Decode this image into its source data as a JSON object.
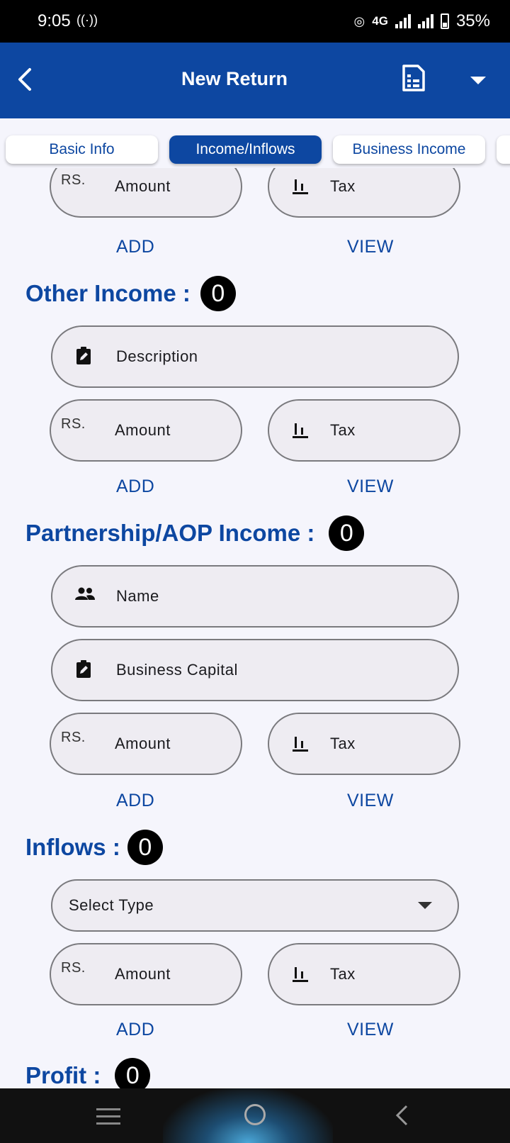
{
  "status": {
    "time": "9:05",
    "network": "4G",
    "battery": "35%"
  },
  "appbar": {
    "title": "New Return"
  },
  "tabs": [
    {
      "label": "Basic Info",
      "active": false
    },
    {
      "label": "Income/Inflows",
      "active": true
    },
    {
      "label": "Business Income",
      "active": false
    }
  ],
  "top_group": {
    "amount_prefix": "RS.",
    "amount_label": "Amount",
    "tax_label": "Tax",
    "add_label": "ADD",
    "view_label": "VIEW"
  },
  "other_income": {
    "title": "Other Income :",
    "count": "0",
    "description_label": "Description",
    "amount_prefix": "RS.",
    "amount_label": "Amount",
    "tax_label": "Tax",
    "add_label": "ADD",
    "view_label": "VIEW"
  },
  "partnership": {
    "title": "Partnership/AOP Income :",
    "count": "0",
    "name_label": "Name",
    "capital_label": "Business Capital",
    "amount_prefix": "RS.",
    "amount_label": "Amount",
    "tax_label": "Tax",
    "add_label": "ADD",
    "view_label": "VIEW"
  },
  "inflows": {
    "title": "Inflows :",
    "count": "0",
    "select_placeholder": "Select Type",
    "amount_prefix": "RS.",
    "amount_label": "Amount",
    "tax_label": "Tax",
    "add_label": "ADD",
    "view_label": "VIEW"
  },
  "profit": {
    "title": "Profit :",
    "count": "0"
  },
  "colors": {
    "primary": "#0d47a1",
    "background": "#f5f5fc",
    "field": "#eeecf2"
  }
}
